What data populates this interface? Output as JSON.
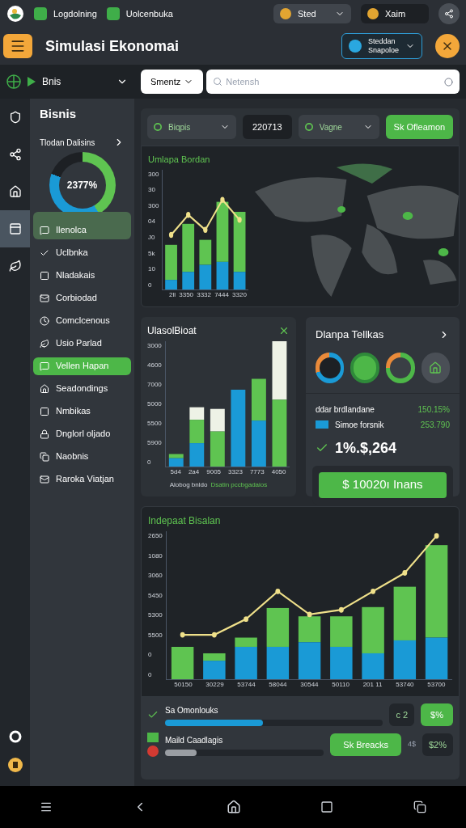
{
  "top_bar": {
    "tabs": [
      {
        "label": "Logdolning"
      },
      {
        "label": "Uolcenbuka"
      }
    ],
    "currency": {
      "label": "Sted"
    },
    "account": {
      "label": "Xaim"
    }
  },
  "header": {
    "title": "Simulasi Ekonomai",
    "profile": {
      "lines": [
        "Steddan",
        "Snapoloe"
      ]
    }
  },
  "toolbar": {
    "mode": "Bnis",
    "filter": "Smentz",
    "search": {
      "placeholder": "Netensh"
    }
  },
  "rail": [
    {
      "kind": "shield",
      "selected": false
    },
    {
      "kind": "share",
      "selected": false
    },
    {
      "kind": "houses",
      "selected": false
    },
    {
      "kind": "panel",
      "selected": true
    },
    {
      "kind": "logo",
      "selected": false
    }
  ],
  "sidebar": {
    "title": "Bisnis",
    "summary": {
      "label": "Tlodan Dalisins",
      "value": "2377%"
    },
    "items": [
      {
        "label": "Ilenolca",
        "selected": false,
        "highlighted": true
      },
      {
        "label": "Uclbnka",
        "selected": false,
        "highlighted": false
      },
      {
        "label": "Nladakais",
        "selected": false,
        "highlighted": false
      },
      {
        "label": "Corbiodad",
        "selected": false,
        "highlighted": false
      },
      {
        "label": "Comclcenous",
        "selected": false,
        "highlighted": false
      },
      {
        "label": "Usio Parlad",
        "selected": false,
        "highlighted": false
      },
      {
        "label": "Vellen Hapan",
        "selected": true,
        "highlighted": false
      },
      {
        "label": "Seadondings",
        "selected": false,
        "highlighted": false
      },
      {
        "label": "Nmbikas",
        "selected": false,
        "highlighted": false
      },
      {
        "label": "Dnglorl oljado",
        "selected": false,
        "highlighted": false
      },
      {
        "label": "Naobnis",
        "selected": false,
        "highlighted": false
      },
      {
        "label": "Raroka Viatjan",
        "selected": false,
        "highlighted": false
      }
    ]
  },
  "filters": {
    "region": "Biqpis",
    "date": "220713",
    "scenario": "Vagne",
    "action": "Sk Ofleamon"
  },
  "map_card": {
    "title": "Umlapa Bordan",
    "y_labels": [
      "300",
      "30",
      "300",
      "04",
      "J0",
      "5k",
      "10",
      "0"
    ],
    "x_labels": [
      "2ll",
      "3350",
      "3332",
      "7444",
      "3320"
    ]
  },
  "bar_card": {
    "title": "UlasolBioat",
    "y_labels": [
      "3000",
      "4600",
      "7000",
      "5000",
      "5500",
      "5900",
      "0"
    ],
    "x_labels": [
      "5d4",
      "2a4",
      "9005",
      "3323",
      "7773",
      "4050"
    ],
    "legend": [
      "Alobog bnldo",
      "Dsatin pccbgadaios"
    ]
  },
  "stats_card": {
    "title": "Dlanpa Tellkas",
    "rows": [
      {
        "label": "ddar brdlandane",
        "value": "150.15%",
        "swatch": false
      },
      {
        "label": "Simoe forsnik",
        "value": "253.790",
        "swatch": true
      }
    ],
    "total": "1%.$,264",
    "button": "$ 10020ı Inans"
  },
  "trend_card": {
    "title": "Indepaat Bisalan",
    "y_labels": [
      "2650",
      "1080",
      "3060",
      "5450",
      "5300",
      "5500",
      "0",
      "0"
    ],
    "x_labels": [
      "50150",
      "30229",
      "53744",
      "58044",
      "30544",
      "50110",
      "201 11",
      "53740",
      "53700"
    ]
  },
  "progress": [
    {
      "label": "Sa Omonlouks",
      "level": 0.45,
      "color": "#1a9ad6",
      "badge": "c 2",
      "action": "$%"
    },
    {
      "label": "Maild Caadlagis",
      "level": 0.2,
      "color": "#9a9ea3",
      "note": "4$",
      "button": "Sk Breacks",
      "badge": "$2%"
    }
  ]
}
